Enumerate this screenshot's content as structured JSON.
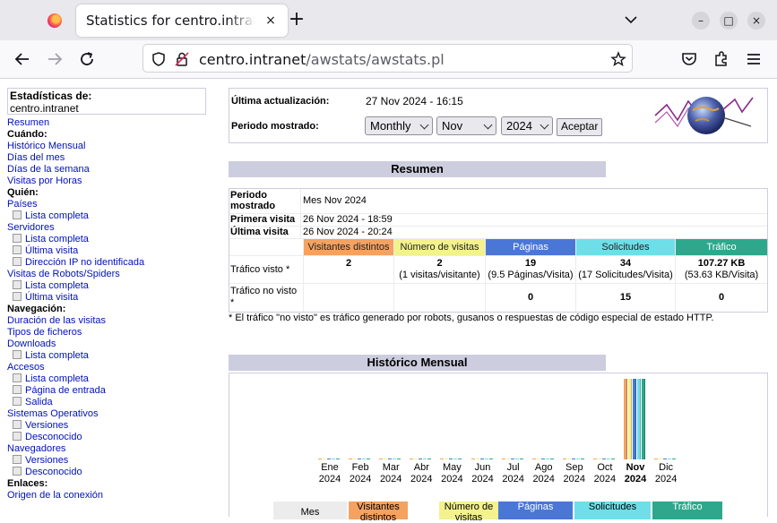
{
  "browser": {
    "tab_title": "Statistics for centro.intranet",
    "tab_close": "×",
    "new_tab": "+",
    "url_host": "centro.intranet",
    "url_path": "/awstats/awstats.pl"
  },
  "sidebar": {
    "site_label": "Estadísticas de:",
    "site_name": "centro.intranet",
    "items": [
      {
        "type": "link",
        "text": "Resumen"
      },
      {
        "type": "head",
        "text": "Cuándo:"
      },
      {
        "type": "link",
        "text": "Histórico Mensual"
      },
      {
        "type": "link",
        "text": "Días del mes"
      },
      {
        "type": "link",
        "text": "Días de la semana"
      },
      {
        "type": "link",
        "text": "Visitas por Horas"
      },
      {
        "type": "head",
        "text": "Quién:"
      },
      {
        "type": "link",
        "text": "Países"
      },
      {
        "type": "sub",
        "text": "Lista completa"
      },
      {
        "type": "link",
        "text": "Servidores"
      },
      {
        "type": "sub",
        "text": "Lista completa"
      },
      {
        "type": "sub",
        "text": "Última visita"
      },
      {
        "type": "sub",
        "text": "Dirección IP no identificada"
      },
      {
        "type": "link",
        "text": "Visitas de Robots/Spiders"
      },
      {
        "type": "sub",
        "text": "Lista completa"
      },
      {
        "type": "sub",
        "text": "Última visita"
      },
      {
        "type": "head",
        "text": "Navegación:"
      },
      {
        "type": "link",
        "text": "Duración de las visitas"
      },
      {
        "type": "link",
        "text": "Tipos de ficheros"
      },
      {
        "type": "link",
        "text": "Downloads"
      },
      {
        "type": "sub",
        "text": "Lista completa"
      },
      {
        "type": "link",
        "text": "Accesos"
      },
      {
        "type": "sub",
        "text": "Lista completa"
      },
      {
        "type": "sub",
        "text": "Página de entrada"
      },
      {
        "type": "sub",
        "text": "Salida"
      },
      {
        "type": "link",
        "text": "Sistemas Operativos"
      },
      {
        "type": "sub",
        "text": "Versiones"
      },
      {
        "type": "sub",
        "text": "Desconocido"
      },
      {
        "type": "link",
        "text": "Navegadores"
      },
      {
        "type": "sub",
        "text": "Versiones"
      },
      {
        "type": "sub",
        "text": "Desconocido"
      },
      {
        "type": "head",
        "text": "Enlaces:"
      },
      {
        "type": "link",
        "text": "Origen de la conexión"
      }
    ]
  },
  "top": {
    "last_update_label": "Última actualización:",
    "last_update_value": "27 Nov 2024 - 16:15",
    "period_label": "Periodo mostrado:",
    "period_select": "Monthly",
    "month_select": "Nov",
    "year_select": "2024",
    "submit_label": "Aceptar"
  },
  "summary": {
    "title": "Resumen",
    "period_label": "Periodo mostrado",
    "period_value": "Mes Nov 2024",
    "first_visit_label": "Primera visita",
    "first_visit_value": "26 Nov 2024 - 18:59",
    "last_visit_label": "Última visita",
    "last_visit_value": "26 Nov 2024 - 20:24",
    "columns": [
      {
        "label": "Visitantes distintos",
        "color": "#f4a261"
      },
      {
        "label": "Número de visitas",
        "color": "#f3f28d"
      },
      {
        "label": "Páginas",
        "color": "#4a77d6"
      },
      {
        "label": "Solicitudes",
        "color": "#6edfe8"
      },
      {
        "label": "Tráfico",
        "color": "#2ea88c"
      }
    ],
    "viewed_label": "Tráfico visto *",
    "viewed": [
      {
        "main": "2",
        "sub": ""
      },
      {
        "main": "2",
        "sub": "(1 visitas/visitante)"
      },
      {
        "main": "19",
        "sub": "(9.5 Páginas/Visita)"
      },
      {
        "main": "34",
        "sub": "(17 Solicitudes/Visita)"
      },
      {
        "main": "107.27 KB",
        "sub": "(53.63 KB/Visita)"
      }
    ],
    "not_viewed_label": "Tráfico no visto *",
    "not_viewed": [
      "",
      "",
      "0",
      "15",
      "0"
    ],
    "note": "* El tráfico \"no visto\" es tráfico generado por robots, gusanos o respuestas de código especial de estado HTTP."
  },
  "history": {
    "title": "Histórico Mensual",
    "months": [
      {
        "m": "Ene",
        "y": "2024"
      },
      {
        "m": "Feb",
        "y": "2024"
      },
      {
        "m": "Mar",
        "y": "2024"
      },
      {
        "m": "Abr",
        "y": "2024"
      },
      {
        "m": "May",
        "y": "2024"
      },
      {
        "m": "Jun",
        "y": "2024"
      },
      {
        "m": "Jul",
        "y": "2024"
      },
      {
        "m": "Ago",
        "y": "2024"
      },
      {
        "m": "Sep",
        "y": "2024"
      },
      {
        "m": "Oct",
        "y": "2024"
      },
      {
        "m": "Nov",
        "y": "2024"
      },
      {
        "m": "Dic",
        "y": "2024"
      }
    ],
    "current_month_index": 10,
    "bottom_headers": [
      "Mes",
      "Visitantes distintos",
      "Número de visitas",
      "Páginas",
      "Solicitudes",
      "Tráfico"
    ]
  },
  "chart_data": {
    "type": "bar",
    "categories": [
      "Ene 2024",
      "Feb 2024",
      "Mar 2024",
      "Abr 2024",
      "May 2024",
      "Jun 2024",
      "Jul 2024",
      "Ago 2024",
      "Sep 2024",
      "Oct 2024",
      "Nov 2024",
      "Dic 2024"
    ],
    "series": [
      {
        "name": "Visitantes distintos",
        "color": "#f4a261",
        "values": [
          0,
          0,
          0,
          0,
          0,
          0,
          0,
          0,
          0,
          0,
          2,
          0
        ]
      },
      {
        "name": "Número de visitas",
        "color": "#f3f28d",
        "values": [
          0,
          0,
          0,
          0,
          0,
          0,
          0,
          0,
          0,
          0,
          2,
          0
        ]
      },
      {
        "name": "Páginas",
        "color": "#4a77d6",
        "values": [
          0,
          0,
          0,
          0,
          0,
          0,
          0,
          0,
          0,
          0,
          19,
          0
        ]
      },
      {
        "name": "Solicitudes",
        "color": "#6edfe8",
        "values": [
          0,
          0,
          0,
          0,
          0,
          0,
          0,
          0,
          0,
          0,
          34,
          0
        ]
      },
      {
        "name": "Tráfico",
        "color": "#2ea88c",
        "values": [
          0,
          0,
          0,
          0,
          0,
          0,
          0,
          0,
          0,
          0,
          107.27,
          0
        ]
      }
    ]
  }
}
